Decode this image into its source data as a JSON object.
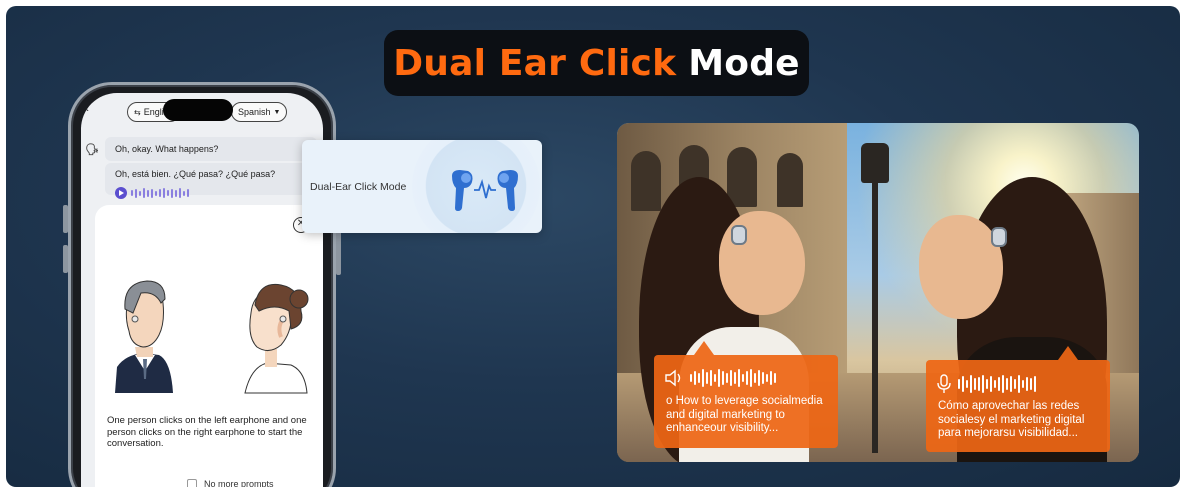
{
  "title": {
    "accent": "Dual Ear Click",
    "rest": "Mode"
  },
  "phone": {
    "lang_left": "English",
    "lang_right": "Spanish",
    "messages": [
      {
        "text": "Oh, okay. What happens?"
      },
      {
        "text": "Oh, está bien. ¿Qué pasa? ¿Qué pasa?"
      }
    ],
    "modal": {
      "instruction": "One person clicks on the left earphone and one person clicks on the right earphone to start the conversation.",
      "checkbox_label": "No more prompts"
    }
  },
  "mode_card": {
    "label": "Dual-Ear Click Mode"
  },
  "captions": {
    "left": "o How to leverage socialmedia and digital marketing to enhanceour visibility...",
    "right": "Cómo aprovechar las redes socialesy el marketing digital para mejorarsu visibilidad..."
  },
  "colors": {
    "accent": "#ff6a10",
    "caption_bg": "#ee6614",
    "banner_bg": "#1f3650",
    "play": "#5b4fcf"
  },
  "icons": [
    "back-chevron-icon",
    "language-swap-icon",
    "chevron-down-icon",
    "speaker-icon",
    "play-icon",
    "close-icon",
    "earbuds-icon",
    "volume-icon",
    "microphone-icon"
  ]
}
